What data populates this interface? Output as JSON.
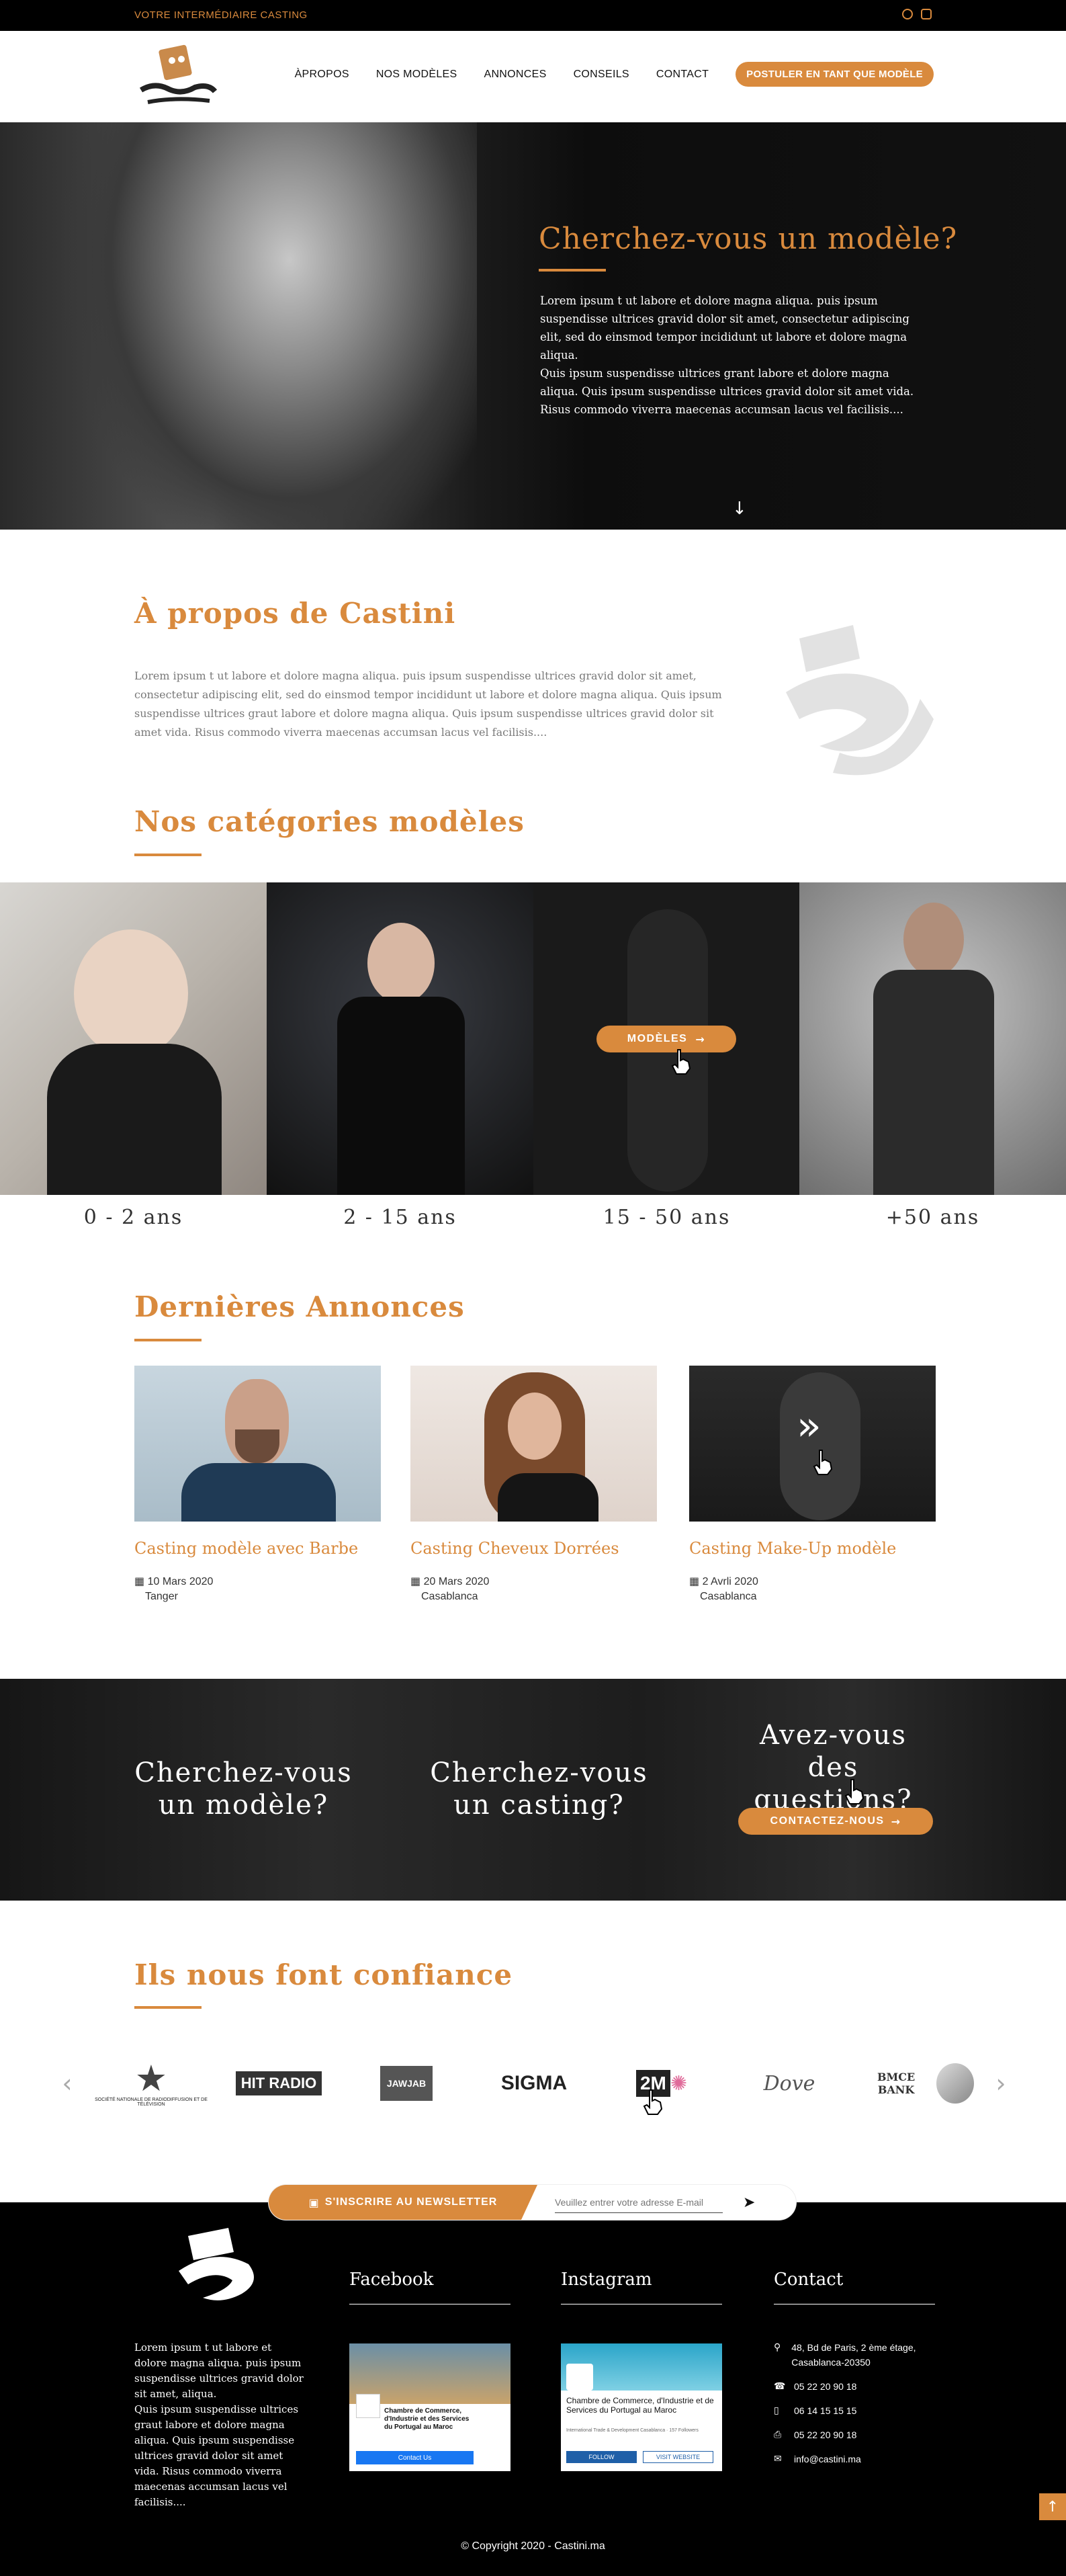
{
  "topbar": {
    "tagline": "VOTRE INTERMÉDIAIRE CASTING",
    "social": [
      "facebook-icon",
      "instagram-icon"
    ]
  },
  "nav": {
    "items": [
      "ÀPROPOS",
      "NOS MODÈLES",
      "ANNONCES",
      "CONSEILS",
      "CONTACT"
    ],
    "cta": "POSTULER EN TANT QUE MODÈLE"
  },
  "hero": {
    "title": "Cherchez-vous un modèle?",
    "text": "Lorem ipsum t ut labore et dolore magna aliqua. puis ipsum suspendisse ultrices gravid dolor sit amet, consectetur adipiscing elit, sed do einsmod tempor incididunt ut labore et dolore magna aliqua.\nQuis ipsum suspendisse ultrices grant labore et dolore magna aliqua. Quis ipsum suspendisse ultrices gravid dolor sit amet vida. Risus commodo viverra maecenas accumsan lacus vel facilisis...."
  },
  "about": {
    "title": "À propos de Castini",
    "text": "Lorem ipsum t ut labore et dolore magna aliqua. puis ipsum suspendisse ultrices gravid dolor sit amet, consectetur adipiscing elit, sed do einsmod tempor incididunt ut labore et dolore magna aliqua. Quis ipsum suspendisse ultrices graut labore et dolore magna aliqua. Quis ipsum suspendisse ultrices gravid dolor sit amet vida. Risus commodo viverra maecenas accumsan lacus vel facilisis...."
  },
  "categories": {
    "title": "Nos catégories modèles",
    "button": "MODÈLES",
    "items": [
      {
        "label": "0 - 2 ans"
      },
      {
        "label": "2 - 15 ans"
      },
      {
        "label": "15 - 50 ans"
      },
      {
        "label": "+50 ans"
      }
    ]
  },
  "annonces": {
    "title": "Dernières Annonces",
    "items": [
      {
        "title": "Casting modèle avec Barbe",
        "date": "10 Mars 2020",
        "city": "Tanger"
      },
      {
        "title": "Casting Cheveux Dorrées",
        "date": "20 Mars 2020",
        "city": "Casablanca"
      },
      {
        "title": "Casting Make-Up modèle",
        "date": "2 Avrli 2020",
        "city": "Casablanca"
      }
    ]
  },
  "cta": {
    "model": "Cherchez-vous\nun modèle?",
    "casting": "Cherchez-vous\nun casting?",
    "questions": "Avez-vous\ndes questions?",
    "button": "CONTACTEZ-NOUS"
  },
  "trust": {
    "title": "Ils nous font confiance",
    "partners": [
      "SOCIÉTÉ NATIONALE DE RADIODIFFUSION ET DE TÉLÉVISION",
      "HIT RADIO",
      "JAWJAB",
      "SIGMA",
      "2M",
      "Dove",
      "BMCE BANK"
    ]
  },
  "newsletter": {
    "label": "S'INSCRIRE AU NEWSLETTER",
    "placeholder": "Veuillez entrer votre adresse E-mail"
  },
  "footer": {
    "text": "Lorem ipsum t ut labore et dolore magna aliqua. puis ipsum suspendisse ultrices gravid dolor sit amet, aliqua.\nQuis ipsum suspendisse ultrices graut labore et dolore magna aliqua. Quis ipsum suspendisse ultrices gravid dolor sit amet vida. Risus commodo viverra maecenas accumsan lacus vel facilisis....",
    "facebook": "Facebook",
    "instagram": "Instagram",
    "contact": "Contact",
    "fb_page": "Chambre de Commerce, d'Industrie et des Services du Portugal au Maroc",
    "fb_button": "Contact Us",
    "ig_page": "Chambre de Commerce, d'Industrie et de Services du Portugal au Maroc",
    "ig_sub": "International Trade & Development Casablanca · 157 Followers",
    "ig_follow": "FOLLOW",
    "ig_visit": "VISIT WEBSITE",
    "address": "48, Bd de Paris, 2 ème étage, Casablanca-20350",
    "phone1": "05 22 20 90 18",
    "mobile": "06 14 15 15 15",
    "fax": "05 22 20 90 18",
    "email": "info@castini.ma",
    "copyright": "© Copyright 2020 - Castini.ma"
  },
  "colors": {
    "accent": "#d98a3d",
    "dark": "#000000"
  }
}
